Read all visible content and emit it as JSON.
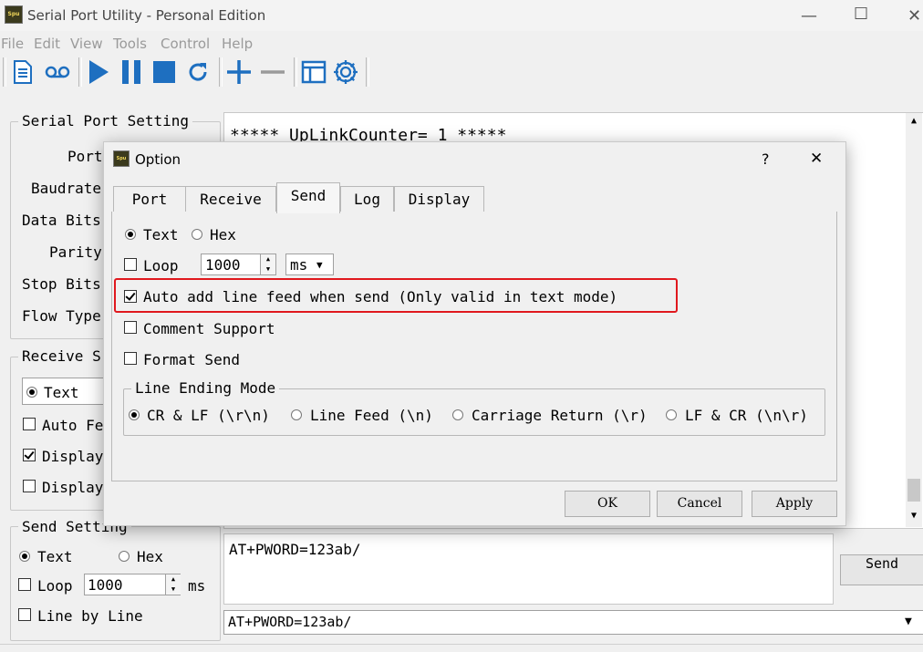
{
  "window": {
    "title": "Serial Port Utility - Personal Edition",
    "icon_text": "Spu"
  },
  "menu": [
    {
      "label": "File"
    },
    {
      "label": "Edit"
    },
    {
      "label": "View"
    },
    {
      "label": "Tools"
    },
    {
      "label": "Control"
    },
    {
      "label": "Help"
    }
  ],
  "toolbar": {
    "icons": [
      "new-document-icon",
      "record-icon",
      "play-icon",
      "pause-icon",
      "stop-icon",
      "refresh-icon",
      "add-icon",
      "remove-icon",
      "window-layout-icon",
      "settings-gear-icon"
    ],
    "accent_color": "#1e6fc0"
  },
  "serial_port_setting": {
    "title": "Serial Port Setting",
    "labels": [
      "Port",
      "Baudrate",
      "Data Bits",
      "Parity",
      "Stop Bits",
      "Flow Type"
    ]
  },
  "receive_setting": {
    "title": "Receive S",
    "text_radio": "Text",
    "auto_feed": "Auto Fe",
    "display1": "Display",
    "display2": "Display"
  },
  "send_setting": {
    "title": "Send Setting",
    "text_radio": "Text",
    "hex_radio": "Hex",
    "loop": "Loop",
    "loop_value": "1000",
    "unit": "ms",
    "line_by_line": "Line by Line"
  },
  "receive_area": {
    "text": "***** UpLinkCounter= 1 *****"
  },
  "send_area": {
    "text": "AT+PWORD=123ab/",
    "send_button": "Send",
    "history_value": "AT+PWORD=123ab/"
  },
  "dialog": {
    "title": "Option",
    "icon_text": "Spu",
    "help": "?",
    "close": "✕",
    "tabs": [
      "Port",
      "Receive",
      "Send",
      "Log",
      "Display"
    ],
    "active_tab": "Send",
    "text_radio": "Text",
    "hex_radio": "Hex",
    "loop_label": "Loop",
    "loop_value": "1000",
    "loop_unit": "ms",
    "auto_line_feed": "Auto add line feed when send (Only valid in text mode)",
    "comment_support": "Comment Support",
    "format_send": "Format Send",
    "line_ending": {
      "title": "Line Ending Mode",
      "options": [
        "CR & LF (\\r\\n)",
        "Line Feed (\\n)",
        "Carriage Return (\\r)",
        "LF & CR (\\n\\r)"
      ]
    },
    "ok": "OK",
    "cancel": "Cancel",
    "apply": "Apply",
    "highlight_color": "#e0181e"
  }
}
